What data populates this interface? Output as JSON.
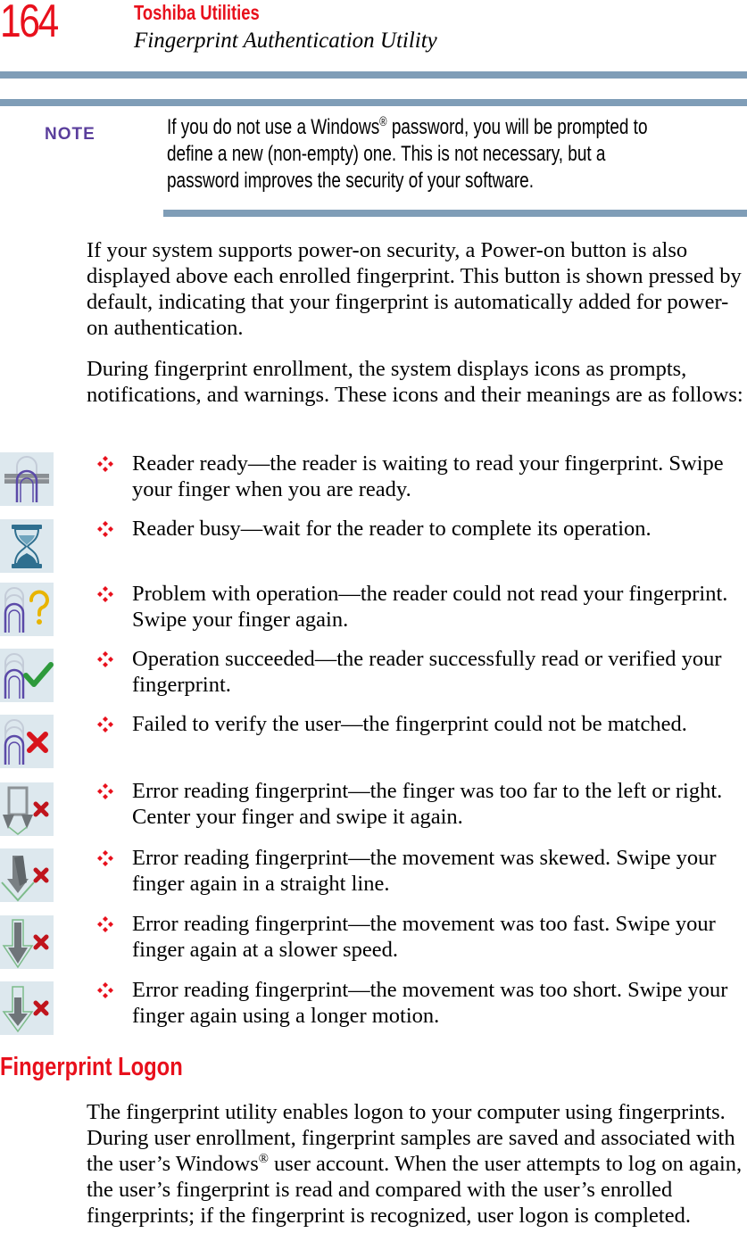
{
  "header": {
    "page_number": "164",
    "chapter": "Toshiba Utilities",
    "section": "Fingerprint Authentication Utility"
  },
  "colors": {
    "accent_red": "#e8101c",
    "rule_blue": "#7f9db7",
    "note_purple": "#5a3e9c",
    "icon_bg": "#dde8ee"
  },
  "note": {
    "label": "NOTE",
    "text_before": "If you do not use a Windows",
    "registered": "®",
    "text_after": " password, you will be prompted to define a new (non-empty) one. This is not necessary, but a password improves the security of your software."
  },
  "paragraphs": [
    "If your system supports power-on security, a Power-on button is also displayed above each enrolled fingerprint. This button is shown pressed by default, indicating that your fingerprint is automatically added for power-on authentication.",
    "During fingerprint enrollment, the system displays icons as prompts, notifications, and warnings. These icons and their meanings are as follows:"
  ],
  "bullet_glyph": "diamond-cluster-bullet",
  "icon_items": [
    {
      "icon": "reader-ready-icon",
      "text": "Reader ready—the reader is waiting to read your fingerprint. Swipe your finger when you are ready."
    },
    {
      "icon": "hourglass-icon",
      "text": "Reader busy—wait for the reader to complete its operation."
    },
    {
      "icon": "finger-question-icon",
      "text": "Problem with operation—the reader could not read your fingerprint. Swipe your finger again."
    },
    {
      "icon": "finger-check-icon",
      "text": "Operation succeeded—the reader successfully read or verified your fingerprint."
    },
    {
      "icon": "finger-x-icon",
      "text": "Failed to verify the user—the fingerprint could not be matched."
    },
    {
      "icon": "double-arrow-x-icon",
      "text": "Error reading fingerprint—the finger was too far to the left or right. Center your finger and swipe it again."
    },
    {
      "icon": "skewed-arrow-x-icon",
      "text": "Error reading fingerprint—the movement was skewed. Swipe your finger again in a straight line."
    },
    {
      "icon": "long-arrow-x-icon",
      "text": "Error reading fingerprint—the movement was too fast. Swipe your finger again at a slower speed."
    },
    {
      "icon": "short-arrow-x-icon",
      "text": "Error reading fingerprint—the movement was too short. Swipe your finger again using a longer motion."
    }
  ],
  "logon_section": {
    "heading": "Fingerprint Logon",
    "text_before": "The fingerprint utility enables logon to your computer using fingerprints. During user enrollment, fingerprint samples are saved and associated with the user’s Windows",
    "registered": "®",
    "text_after": " user account. When the user attempts to log on again, the user’s fingerprint is read and compared with the user’s enrolled fingerprints; if the fingerprint is recognized, user logon is completed."
  }
}
